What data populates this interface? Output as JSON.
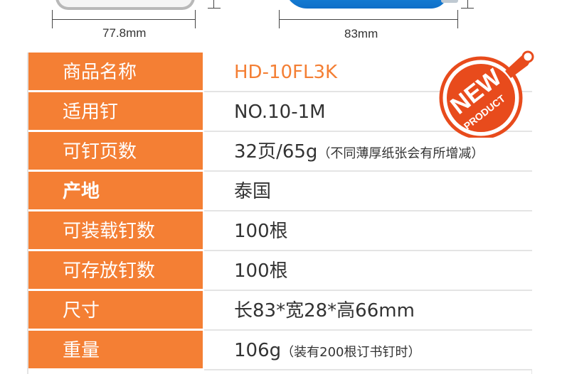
{
  "dimensions": {
    "left_width": "77.8mm",
    "right_width": "83mm"
  },
  "badge": {
    "line1": "NEW",
    "line2": "PRODUCT",
    "color": "#e84b1c"
  },
  "colors": {
    "label_bg": "#f47f34",
    "accent_text": "#f47f34"
  },
  "specs": [
    {
      "label": "商品名称",
      "value": "HD-10FL3K",
      "note": ""
    },
    {
      "label": "适用钉",
      "value": "NO.10-1M",
      "note": ""
    },
    {
      "label": "可钉页数",
      "value": "32页/65g",
      "note": "（不同薄厚纸张会有所增减）"
    },
    {
      "label": "产地",
      "value": "泰国",
      "note": ""
    },
    {
      "label": "可装载钉数",
      "value": "100根",
      "note": ""
    },
    {
      "label": "可存放钉数",
      "value": "100根",
      "note": ""
    },
    {
      "label": "尺寸",
      "value": "长83*宽28*高66mm",
      "note": ""
    },
    {
      "label": "重量",
      "value": "106g",
      "note": "（装有200根订书钉时）"
    }
  ]
}
